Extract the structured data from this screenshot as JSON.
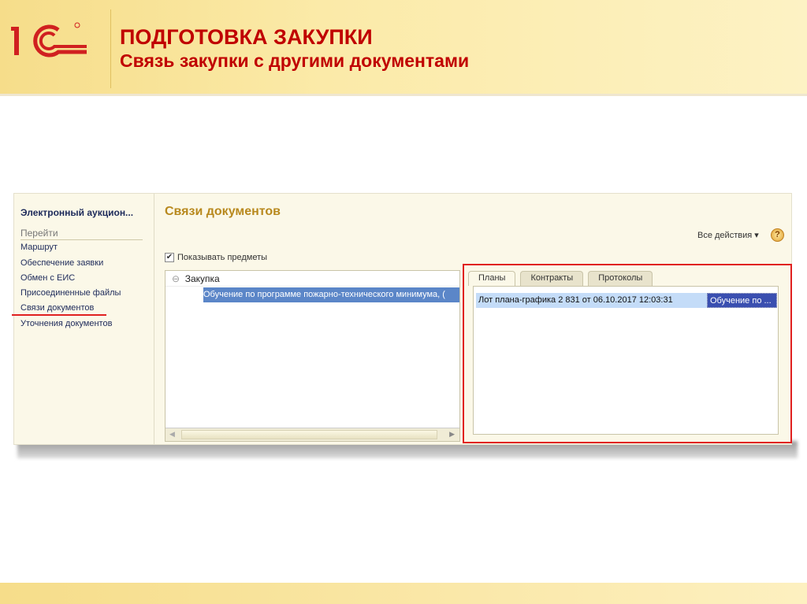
{
  "slide": {
    "title": "ПОДГОТОВКА ЗАКУПКИ",
    "subtitle": "Связь закупки с другими документами",
    "logo": "1С"
  },
  "sidebar": {
    "header": "Электронный аукцион...",
    "go_label": "Перейти",
    "items": [
      {
        "label": "Маршрут"
      },
      {
        "label": "Обеспечение заявки"
      },
      {
        "label": "Обмен с ЕИС"
      },
      {
        "label": "Присоединенные файлы"
      },
      {
        "label": "Связи документов"
      },
      {
        "label": "Уточнения документов"
      }
    ]
  },
  "main": {
    "title": "Связи документов",
    "all_actions": "Все действия",
    "help": "?",
    "show_items_label": "Показывать предметы",
    "show_items_checked": true,
    "tree": {
      "root": "Закупка",
      "child": "Обучение по программе пожарно-технического минимума, ("
    },
    "tabs": [
      {
        "label": "Планы"
      },
      {
        "label": "Контракты"
      },
      {
        "label": "Протоколы"
      }
    ],
    "list": {
      "row": "Лот плана-графика 2 831 от 06.10.2017 12:03:31",
      "row_extra": "Обучение по ..."
    }
  },
  "colors": {
    "accent_red": "#c00000",
    "highlight": "#e02020"
  }
}
